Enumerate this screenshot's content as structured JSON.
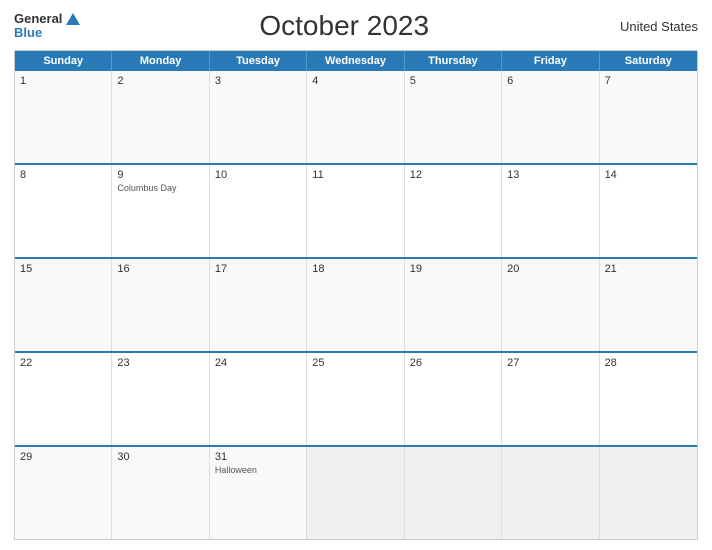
{
  "header": {
    "logo_general": "General",
    "logo_blue": "Blue",
    "title": "October 2023",
    "country": "United States"
  },
  "calendar": {
    "days_of_week": [
      "Sunday",
      "Monday",
      "Tuesday",
      "Wednesday",
      "Thursday",
      "Friday",
      "Saturday"
    ],
    "weeks": [
      [
        {
          "day": "1",
          "event": ""
        },
        {
          "day": "2",
          "event": ""
        },
        {
          "day": "3",
          "event": ""
        },
        {
          "day": "4",
          "event": ""
        },
        {
          "day": "5",
          "event": ""
        },
        {
          "day": "6",
          "event": ""
        },
        {
          "day": "7",
          "event": ""
        }
      ],
      [
        {
          "day": "8",
          "event": ""
        },
        {
          "day": "9",
          "event": "Columbus Day"
        },
        {
          "day": "10",
          "event": ""
        },
        {
          "day": "11",
          "event": ""
        },
        {
          "day": "12",
          "event": ""
        },
        {
          "day": "13",
          "event": ""
        },
        {
          "day": "14",
          "event": ""
        }
      ],
      [
        {
          "day": "15",
          "event": ""
        },
        {
          "day": "16",
          "event": ""
        },
        {
          "day": "17",
          "event": ""
        },
        {
          "day": "18",
          "event": ""
        },
        {
          "day": "19",
          "event": ""
        },
        {
          "day": "20",
          "event": ""
        },
        {
          "day": "21",
          "event": ""
        }
      ],
      [
        {
          "day": "22",
          "event": ""
        },
        {
          "day": "23",
          "event": ""
        },
        {
          "day": "24",
          "event": ""
        },
        {
          "day": "25",
          "event": ""
        },
        {
          "day": "26",
          "event": ""
        },
        {
          "day": "27",
          "event": ""
        },
        {
          "day": "28",
          "event": ""
        }
      ],
      [
        {
          "day": "29",
          "event": ""
        },
        {
          "day": "30",
          "event": ""
        },
        {
          "day": "31",
          "event": "Halloween"
        },
        {
          "day": "",
          "event": ""
        },
        {
          "day": "",
          "event": ""
        },
        {
          "day": "",
          "event": ""
        },
        {
          "day": "",
          "event": ""
        }
      ]
    ]
  }
}
